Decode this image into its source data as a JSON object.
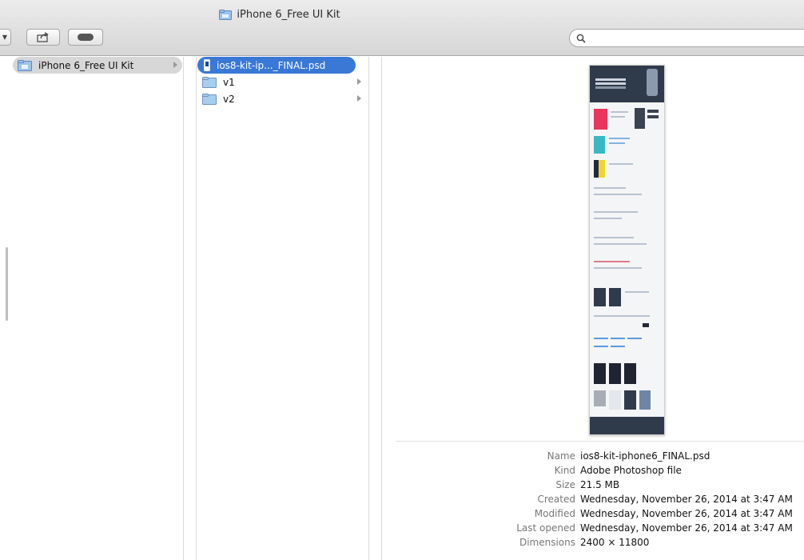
{
  "window": {
    "title": "iPhone 6_Free UI Kit"
  },
  "toolbar": {
    "search_placeholder": ""
  },
  "sidebar": {
    "items": [
      {
        "label": "iPhone 6_Free UI Kit",
        "icon": "folder-icon",
        "selected": true
      }
    ]
  },
  "column2": {
    "items": [
      {
        "label": "ios8-kit-ip..._FINAL.psd",
        "icon": "psd-file-icon",
        "selected": true
      },
      {
        "label": "v1",
        "icon": "folder-icon"
      },
      {
        "label": "v2",
        "icon": "folder-icon"
      }
    ]
  },
  "info": {
    "rows": [
      {
        "key": "Name",
        "value": "ios8-kit-iphone6_FINAL.psd"
      },
      {
        "key": "Kind",
        "value": "Adobe Photoshop file"
      },
      {
        "key": "Size",
        "value": "21.5 MB"
      },
      {
        "key": "Created",
        "value": "Wednesday, November 26, 2014 at 3:47 AM"
      },
      {
        "key": "Modified",
        "value": "Wednesday, November 26, 2014 at 3:47 AM"
      },
      {
        "key": "Last opened",
        "value": "Wednesday, November 26, 2014 at 3:47 AM"
      },
      {
        "key": "Dimensions",
        "value": "2400 × 11800"
      }
    ]
  },
  "colors": {
    "selection_blue": "#3a78d6",
    "selection_gray": "#d7d7d7",
    "toolbar_top": "#ececec",
    "toolbar_bottom": "#d6d6d6"
  }
}
